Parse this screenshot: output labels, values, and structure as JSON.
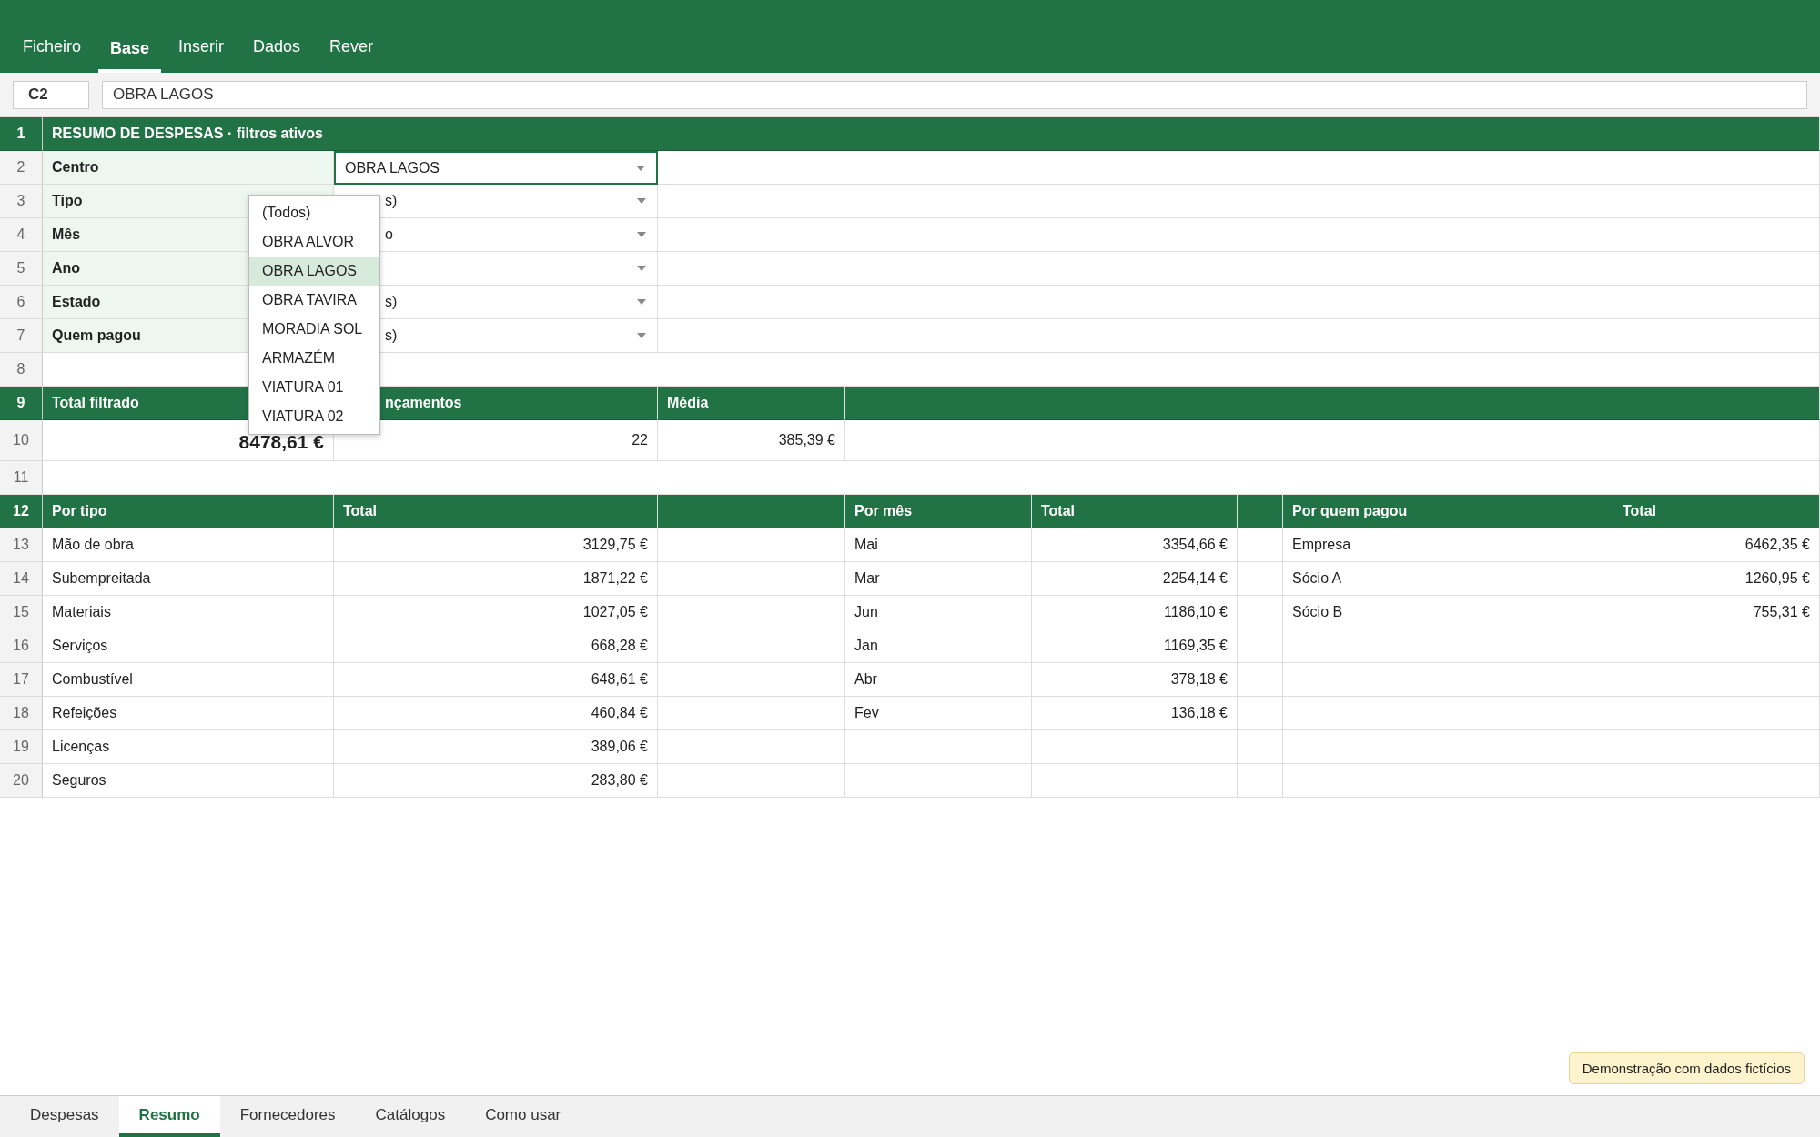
{
  "ribbon": {
    "tabs": [
      {
        "label": "Ficheiro",
        "selected": false
      },
      {
        "label": "Base",
        "selected": true
      },
      {
        "label": "Inserir",
        "selected": false
      },
      {
        "label": "Dados",
        "selected": false
      },
      {
        "label": "Rever",
        "selected": false
      }
    ]
  },
  "formula_bar": {
    "cell_ref": "C2",
    "value": "OBRA LAGOS"
  },
  "sheet": {
    "rows": [
      {
        "kind": "title",
        "number": "1",
        "text": "RESUMO DE DESPESAS · filtros ativos"
      },
      {
        "kind": "filter",
        "number": "2",
        "label": "Centro",
        "value": "OBRA LAGOS",
        "active": true
      },
      {
        "kind": "filter",
        "number": "3",
        "label": "Tipo",
        "value": "s)",
        "active": false
      },
      {
        "kind": "filter",
        "number": "4",
        "label": "Mês",
        "value": "o",
        "active": false
      },
      {
        "kind": "filter",
        "number": "5",
        "label": "Ano",
        "active": false
      },
      {
        "kind": "filter",
        "number": "6",
        "label": "Estado",
        "value": "s)",
        "active": false
      },
      {
        "kind": "filter",
        "number": "7",
        "label": "Quem pagou",
        "value": "s)",
        "active": false
      },
      {
        "kind": "blank",
        "number": "8"
      },
      {
        "kind": "kpi_header",
        "number": "9",
        "cells": [
          "Total filtrado",
          "nçamentos",
          "Média"
        ]
      },
      {
        "kind": "kpi_values",
        "number": "10",
        "cells": [
          "8478,61 €",
          "22",
          "385,39 €"
        ]
      },
      {
        "kind": "blank",
        "number": "11"
      },
      {
        "kind": "group_header",
        "number": "12",
        "groups": [
          {
            "title": "Por tipo",
            "total": "Total"
          },
          {
            "title": "Por mês",
            "total": "Total"
          },
          {
            "title": "Por quem pagou",
            "total": "Total"
          }
        ]
      },
      {
        "kind": "group_data",
        "number": "13",
        "groups": [
          {
            "name": "Mão de obra",
            "total": "3129,75 €"
          },
          {
            "name": "Mai",
            "total": "3354,66 €"
          },
          {
            "name": "Empresa",
            "total": "6462,35 €"
          }
        ]
      },
      {
        "kind": "group_data",
        "number": "14",
        "groups": [
          {
            "name": "Subempreitada",
            "total": "1871,22 €"
          },
          {
            "name": "Mar",
            "total": "2254,14 €"
          },
          {
            "name": "Sócio A",
            "total": "1260,95 €"
          }
        ]
      },
      {
        "kind": "group_data",
        "number": "15",
        "groups": [
          {
            "name": "Materiais",
            "total": "1027,05 €"
          },
          {
            "name": "Jun",
            "total": "1186,10 €"
          },
          {
            "name": "Sócio B",
            "total": "755,31 €"
          }
        ]
      },
      {
        "kind": "group_data",
        "number": "16",
        "groups": [
          {
            "name": "Serviços",
            "total": "668,28 €"
          },
          {
            "name": "Jan",
            "total": "1169,35 €"
          }
        ]
      },
      {
        "kind": "group_data",
        "number": "17",
        "groups": [
          {
            "name": "Combustível",
            "total": "648,61 €"
          },
          {
            "name": "Abr",
            "total": "378,18 €"
          }
        ]
      },
      {
        "kind": "group_data",
        "number": "18",
        "groups": [
          {
            "name": "Refeições",
            "total": "460,84 €"
          },
          {
            "name": "Fev",
            "total": "136,18 €"
          }
        ]
      },
      {
        "kind": "group_data",
        "number": "19",
        "groups": [
          {
            "name": "Licenças",
            "total": "389,06 €"
          }
        ]
      },
      {
        "kind": "group_data",
        "number": "20",
        "groups": [
          {
            "name": "Seguros",
            "total": "283,80 €"
          }
        ]
      }
    ]
  },
  "dropdown": {
    "items": [
      {
        "label": "(Todos)",
        "selected": false
      },
      {
        "label": "OBRA ALVOR",
        "selected": false
      },
      {
        "label": "OBRA LAGOS",
        "selected": true
      },
      {
        "label": "OBRA TAVIRA",
        "selected": false
      },
      {
        "label": "MORADIA SOL",
        "selected": false
      },
      {
        "label": "ARMAZÉM",
        "selected": false
      },
      {
        "label": "VIATURA 01",
        "selected": false
      },
      {
        "label": "VIATURA 02",
        "selected": false
      }
    ]
  },
  "notice": "Demonstração com dados fictícios",
  "sheet_tabs": [
    {
      "label": "Despesas",
      "selected": false
    },
    {
      "label": "Resumo",
      "selected": true
    },
    {
      "label": "Fornecedores",
      "selected": false
    },
    {
      "label": "Catálogos",
      "selected": false
    },
    {
      "label": "Como usar",
      "selected": false
    }
  ]
}
